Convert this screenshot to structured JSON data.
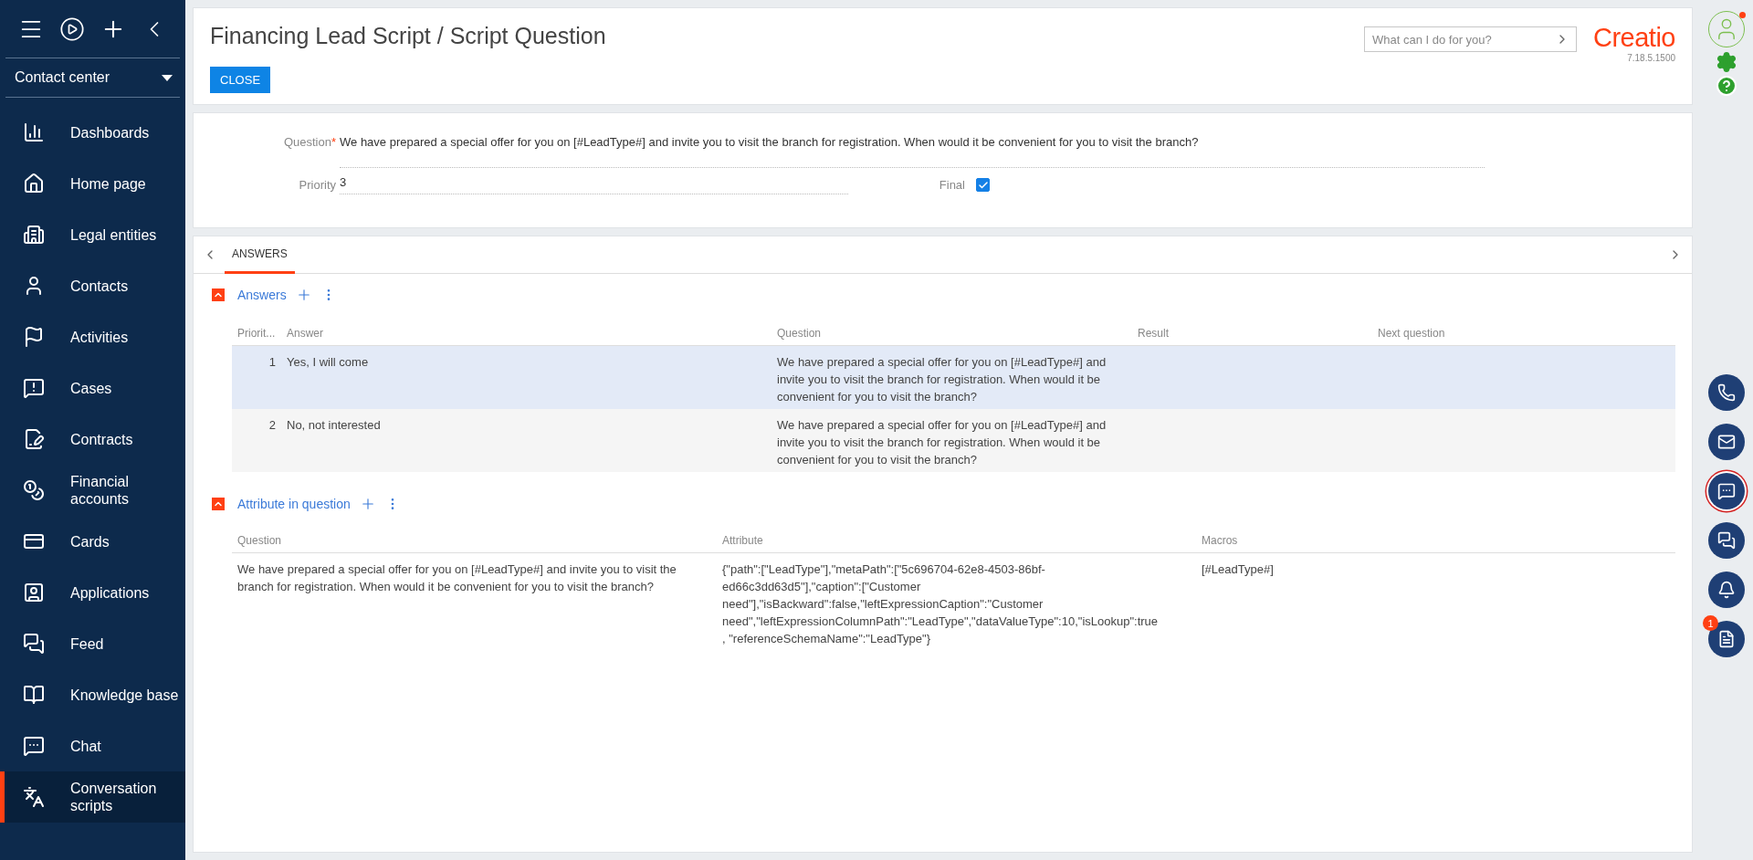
{
  "sidebar": {
    "workplace": "Contact center",
    "items": [
      {
        "label": "Dashboards",
        "selected": false
      },
      {
        "label": "Home page",
        "selected": false
      },
      {
        "label": "Legal entities",
        "selected": false
      },
      {
        "label": "Contacts",
        "selected": false
      },
      {
        "label": "Activities",
        "selected": false
      },
      {
        "label": "Cases",
        "selected": false
      },
      {
        "label": "Contracts",
        "selected": false
      },
      {
        "label": "Financial accounts",
        "selected": false
      },
      {
        "label": "Cards",
        "selected": false
      },
      {
        "label": "Applications",
        "selected": false
      },
      {
        "label": "Feed",
        "selected": false
      },
      {
        "label": "Knowledge base",
        "selected": false
      },
      {
        "label": "Chat",
        "selected": false
      },
      {
        "label": "Conversation scripts",
        "selected": true
      }
    ]
  },
  "header": {
    "title": "Financing Lead Script / Script Question",
    "close_button": "CLOSE",
    "search": {
      "placeholder": "What can I do for you?"
    },
    "logo": "Creatio",
    "version": "7.18.5.1500"
  },
  "form": {
    "question_label": "Question",
    "required_mark": "*",
    "question": "We have prepared a special offer for you on [#LeadType#] and invite you to visit the branch for registration. When would it be convenient for you to visit the branch?",
    "priority_label": "Priority",
    "priority": "3",
    "final_label": "Final",
    "final_checked": true
  },
  "tabs": [
    {
      "label": "ANSWERS",
      "selected": true
    }
  ],
  "answers": {
    "title": "Answers",
    "columns": [
      "Priorit...",
      "Answer",
      "Question",
      "Result",
      "Next question"
    ],
    "rows": [
      {
        "priority": "1",
        "answer": "Yes, I will come",
        "question": "We have prepared a special offer for you on [#LeadType#] and invite you to visit the branch for registration. When would it be convenient for you to visit the branch?",
        "selected": true
      },
      {
        "priority": "2",
        "answer": "No, not interested",
        "question": "We have prepared a special offer for you on [#LeadType#] and invite you to visit the branch for registration. When would it be convenient for you to visit the branch?",
        "selected": false
      }
    ]
  },
  "attributes": {
    "title": "Attribute in question",
    "columns": [
      "Question",
      "Attribute",
      "Macros"
    ],
    "rows": [
      {
        "question": "We have prepared a special offer for you on [#LeadType#] and invite you to visit the branch for registration. When would it be convenient for you to visit the branch?",
        "attribute": "{\"path\":[\"LeadType\"],\"metaPath\":[\"5c696704-62e8-4503-86bf-ed66c3dd63d5\"],\"caption\":[\"Customer need\"],\"isBackward\":false,\"leftExpressionCaption\":\"Customer need\",\"leftExpressionColumnPath\":\"LeadType\",\"dataValueType\":10,\"isLookup\":true, \"referenceSchemaName\":\"LeadType\"}",
        "macros": "[#LeadType#]"
      }
    ]
  },
  "right_panel": {
    "buttons": [
      {
        "kind": "phone",
        "selected": false
      },
      {
        "kind": "email",
        "selected": false
      },
      {
        "kind": "chat",
        "selected": true
      },
      {
        "kind": "feed",
        "selected": false
      },
      {
        "kind": "notifications",
        "selected": false
      },
      {
        "kind": "processes",
        "selected": false,
        "badge": "1"
      }
    ]
  }
}
